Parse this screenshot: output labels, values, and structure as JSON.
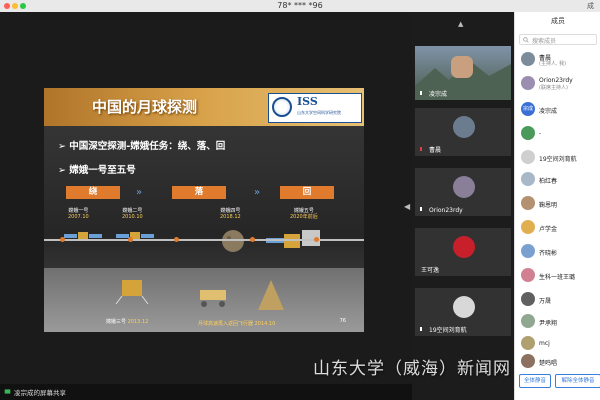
{
  "window": {
    "title": "78* *** *96",
    "right_label": "成"
  },
  "slide": {
    "title": "中国的月球探测",
    "logo_text": "ISS",
    "logo_subtitle": "山东大学空间科学研究院",
    "bullet1": "中国深空探测-嫦娥任务：绕、落、回",
    "bullet2": "嫦娥一号至五号",
    "bullet_arrow": "➢",
    "phases": [
      "绕",
      "落",
      "回"
    ],
    "chevron": "»",
    "missions": [
      {
        "name": "嫦娥一号",
        "year": "2007.10"
      },
      {
        "name": "嫦娥二号",
        "year": "2010.10"
      },
      {
        "name": "嫦娥四号",
        "year": "2018.12"
      },
      {
        "name": "嫦娥五号",
        "year": "2020年前后"
      }
    ],
    "lower_mission_name": "嫦娥三号",
    "lower_mission_year": "2013.12",
    "bottom_caption": "月球高速再入返回飞行器 2014.10",
    "page_number": "76"
  },
  "share_bar": {
    "label": "凌宗成的屏幕共享"
  },
  "gallery": {
    "up_arrow": "▲",
    "side_arrow": "◀",
    "tiles": [
      {
        "name": "凌宗成",
        "color": "#5d7a96"
      },
      {
        "name": "曹晨",
        "color": "#6b7c8f"
      },
      {
        "name": "Orion23rdy",
        "color": "#8a7f99"
      },
      {
        "name": "王可逸",
        "color": "#c8202a"
      },
      {
        "name": "19空间刘育航",
        "color": "#cccccc"
      }
    ]
  },
  "panel": {
    "title": "成员",
    "search_placeholder": "搜索成员",
    "members": [
      {
        "name": "曹晨",
        "sub": "(主持人, 我)",
        "color": "#7c8c9a"
      },
      {
        "name": "Orion23rdy",
        "sub": "(联席主持人)",
        "color": "#9a8fb0"
      },
      {
        "name": "凌宗成",
        "sub": "",
        "color": "#3b6fd6",
        "avatar_text": "宗成"
      },
      {
        "name": "-",
        "sub": "",
        "color": "#4a9a5a"
      },
      {
        "name": "19空间刘育航",
        "sub": "",
        "color": "#cfcfcf"
      },
      {
        "name": "柏红春",
        "sub": "",
        "color": "#a8b8c8"
      },
      {
        "name": "鞠恩明",
        "sub": "",
        "color": "#b29070"
      },
      {
        "name": "卢学金",
        "sub": "",
        "color": "#e0b050"
      },
      {
        "name": "齐晓彬",
        "sub": "",
        "color": "#7aa0d0"
      },
      {
        "name": "生科一班王璐",
        "sub": "",
        "color": "#d08090"
      },
      {
        "name": "万晟",
        "sub": "",
        "color": "#606060"
      },
      {
        "name": "尹承翔",
        "sub": "",
        "color": "#90a890"
      },
      {
        "name": "mcj",
        "sub": "",
        "color": "#b0a070"
      },
      {
        "name": "楚鸣唱",
        "sub": "",
        "color": "#8c7060"
      }
    ],
    "mute_all_label": "全体静音",
    "unmute_all_label": "解除全体静音"
  },
  "watermark": "山东大学（威海）新闻网",
  "colors": {
    "accent": "#3b7ddd",
    "phase": "#e07a2c"
  }
}
